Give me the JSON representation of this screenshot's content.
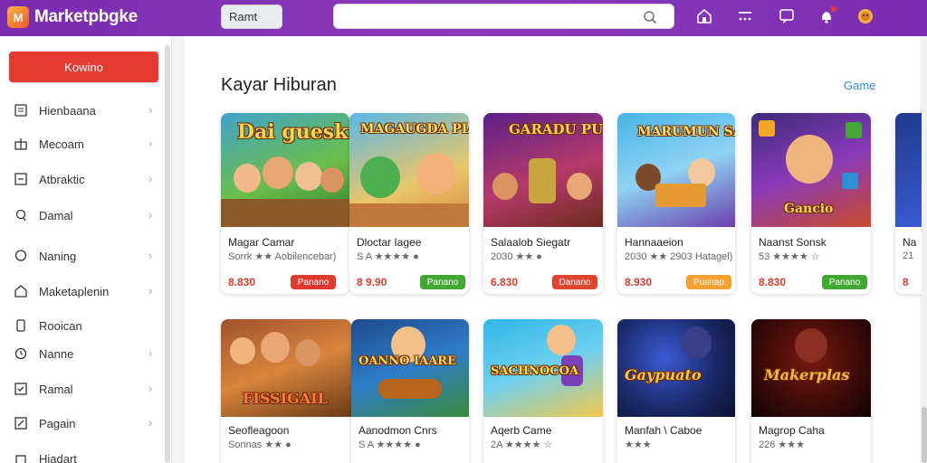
{
  "app": {
    "title": "Marketpbgke",
    "logo_mark": "M"
  },
  "header": {
    "pill_label": "Ramt",
    "search_placeholder": "",
    "icons": [
      "store-icon",
      "menu-dots-icon",
      "chat-icon",
      "notification-icon",
      "avatar-icon"
    ]
  },
  "sidebar": {
    "cta_label": "Kowino",
    "items": [
      {
        "label": "Hienbaana",
        "icon": "book-icon"
      },
      {
        "label": "Mecoam",
        "icon": "gift-icon"
      },
      {
        "label": "Atbraktic",
        "icon": "minus-box-icon"
      },
      {
        "label": "Damal",
        "icon": "pin-icon"
      },
      {
        "label": "Naning",
        "icon": "chat-bubble-icon"
      },
      {
        "label": "Maketaplenin",
        "icon": "store-icon"
      },
      {
        "label": "Rooican",
        "icon": "phone-icon"
      },
      {
        "label": "Nanne",
        "icon": "clock-icon"
      },
      {
        "label": "Ramal",
        "icon": "check-box-icon"
      },
      {
        "label": "Pagain",
        "icon": "edit-icon"
      },
      {
        "label": "Hiadart",
        "icon": "bag-icon"
      }
    ]
  },
  "main": {
    "section_title": "Kayar Hiburan",
    "section_link": "Game",
    "row1": [
      {
        "art": "Dai gueskugan",
        "title": "Magar Camar",
        "meta": "Sorrk ★★ Aobilencebar)",
        "price": "8.830",
        "btn": "Panano",
        "btn_color": "#e03a2f"
      },
      {
        "art": "MAGAUGDA PIANGAI",
        "title": "Dloctar Iagee",
        "meta": "S A ★★★★ ●",
        "price": "8 9.90",
        "btn": "Panano",
        "btn_color": "#43a833"
      },
      {
        "art": "GARADU PUHUAG",
        "title": "Salaalob Siegatr",
        "meta": "2030 ★★ ●",
        "price": "6.830",
        "btn": "Danano",
        "btn_color": "#e0462f"
      },
      {
        "art": "MARUMUN SACOIAK",
        "title": "Hannaaeion",
        "meta": "2030 ★★ 2903 Hatagel)",
        "price": "8.930",
        "btn": "Pusnap",
        "btn_color": "#f5a030"
      },
      {
        "art": "Gancio",
        "title": "Naanst Sonsk",
        "meta": "53 ★★★★ ☆",
        "price": "8.830",
        "btn": "Panano",
        "btn_color": "#43a833"
      },
      {
        "art": "",
        "title": "Na",
        "meta": "21",
        "price": "8",
        "btn": "",
        "btn_color": "#43a833"
      }
    ],
    "row2": [
      {
        "art": "FISSIGAIL",
        "title": "Seofleagoon",
        "meta": "Sonnas ★★ ●",
        "price": "",
        "btn": "",
        "btn_color": "#e03a2f"
      },
      {
        "art": "OANNO IAARE",
        "title": "Aanodmon Cnrs",
        "meta": "S A ★★★★ ●",
        "price": "",
        "btn": "",
        "btn_color": "#43a833"
      },
      {
        "art": "SACHNOCOA",
        "title": "Aqerb Came",
        "meta": "2A ★★★★ ☆",
        "price": "",
        "btn": "",
        "btn_color": "#e0462f"
      },
      {
        "art": "Gaypuato",
        "title": "Manfah \\ Caboe",
        "meta": "★★★",
        "price": "",
        "btn": "",
        "btn_color": "#f5a030"
      },
      {
        "art": "Makerplas",
        "title": "Magrop Caha",
        "meta": "226 ★★★",
        "price": "",
        "btn": "",
        "btn_color": "#43a833"
      }
    ]
  },
  "colors": {
    "brand": "#7a2bb0",
    "cta": "#e53a2f",
    "link": "#2d8fd5",
    "star": "#f5a623"
  }
}
